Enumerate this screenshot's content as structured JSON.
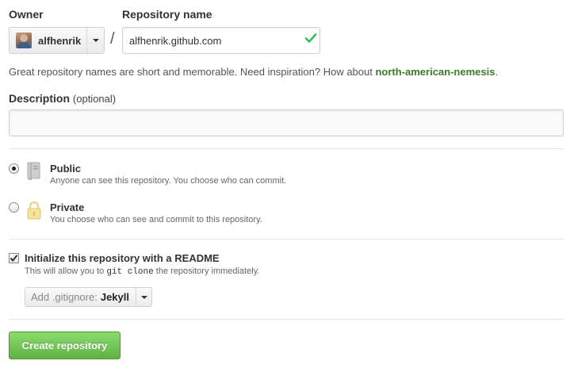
{
  "owner": {
    "label": "Owner",
    "selected": "alfhenrik",
    "avatar_icon": "user-avatar"
  },
  "separator": "/",
  "repository": {
    "label": "Repository name",
    "value": "alfhenrik.github.com",
    "valid_icon": "check-icon",
    "valid_color": "#2cbe4e"
  },
  "hint": {
    "text": "Great repository names are short and memorable. Need inspiration? How about ",
    "suggestion": "north-american-nemesis",
    "suffix": "."
  },
  "description": {
    "label": "Description",
    "optional": "(optional)",
    "value": ""
  },
  "visibility": {
    "public": {
      "title": "Public",
      "desc": "Anyone can see this repository. You choose who can commit.",
      "icon": "book-icon",
      "checked": true
    },
    "private": {
      "title": "Private",
      "desc": "You choose who can see and commit to this repository.",
      "icon": "lock-icon",
      "checked": false
    }
  },
  "readme": {
    "title": "Initialize this repository with a README",
    "desc_before": "This will allow you to ",
    "desc_code": "git clone",
    "desc_after": " the repository immediately.",
    "checked": true
  },
  "gitignore": {
    "prefix": "Add .gitignore:",
    "value": "Jekyll"
  },
  "submit": {
    "label": "Create repository",
    "color": "#60b044"
  }
}
